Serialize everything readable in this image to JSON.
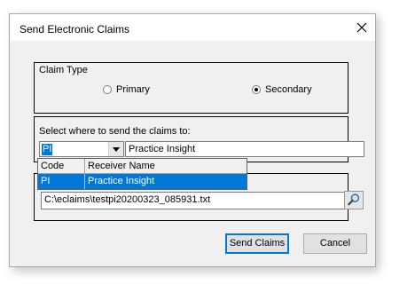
{
  "window": {
    "title": "Send Electronic Claims"
  },
  "claim_type": {
    "label": "Claim Type",
    "options": [
      {
        "label": "Primary",
        "selected": false
      },
      {
        "label": "Secondary",
        "selected": true
      }
    ]
  },
  "destination": {
    "label": "Select where to send the claims to:",
    "code": "PI",
    "receiver_name": "Practice Insight",
    "dropdown": {
      "columns": [
        "Code",
        "Receiver Name"
      ],
      "rows": [
        {
          "code": "PI",
          "name": "Practice Insight",
          "selected": true
        }
      ]
    }
  },
  "output": {
    "file_path": "C:\\eclaims\\testpi20200323_085931.txt"
  },
  "buttons": {
    "send": "Send Claims",
    "cancel": "Cancel"
  },
  "colors": {
    "selection": "#0078d7",
    "dialog_bg": "#f0f0f0"
  }
}
